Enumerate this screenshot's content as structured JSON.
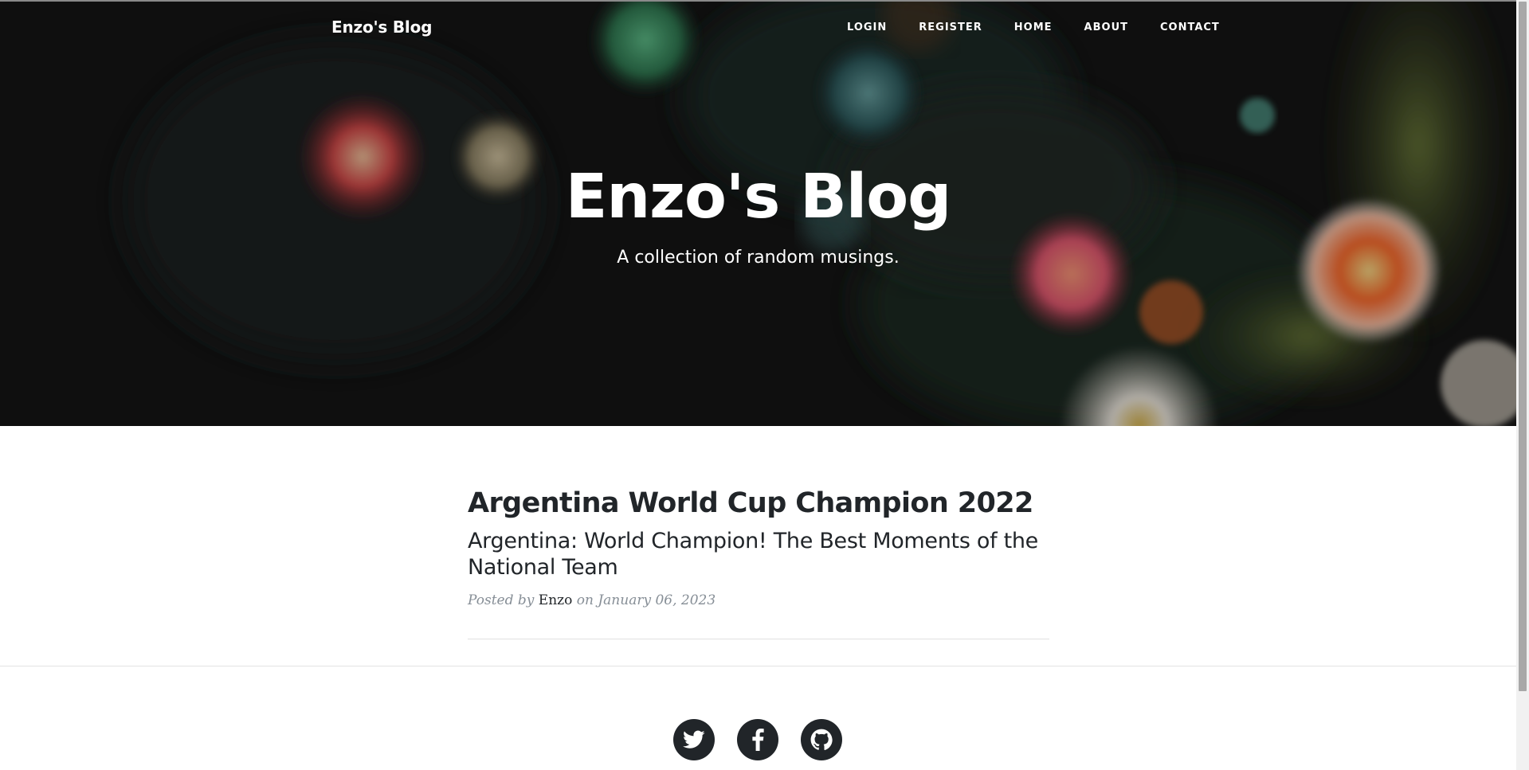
{
  "nav": {
    "brand": "Enzo's Blog",
    "links": [
      "LOGIN",
      "REGISTER",
      "HOME",
      "ABOUT",
      "CONTACT"
    ]
  },
  "hero": {
    "title": "Enzo's Blog",
    "subtitle": "A collection of random musings."
  },
  "post": {
    "title": "Argentina World Cup Champion 2022",
    "subtitle": "Argentina: World Champion! The Best Moments of the National Team",
    "meta_prefix": "Posted by",
    "author": "Enzo",
    "meta_on": "on",
    "date": "January 06, 2023"
  },
  "footer": {
    "social": [
      "twitter-icon",
      "facebook-icon",
      "github-icon"
    ]
  },
  "colors": {
    "text": "#212529",
    "muted": "#868e96",
    "hero_text": "#ffffff",
    "social_bg": "#212529"
  }
}
